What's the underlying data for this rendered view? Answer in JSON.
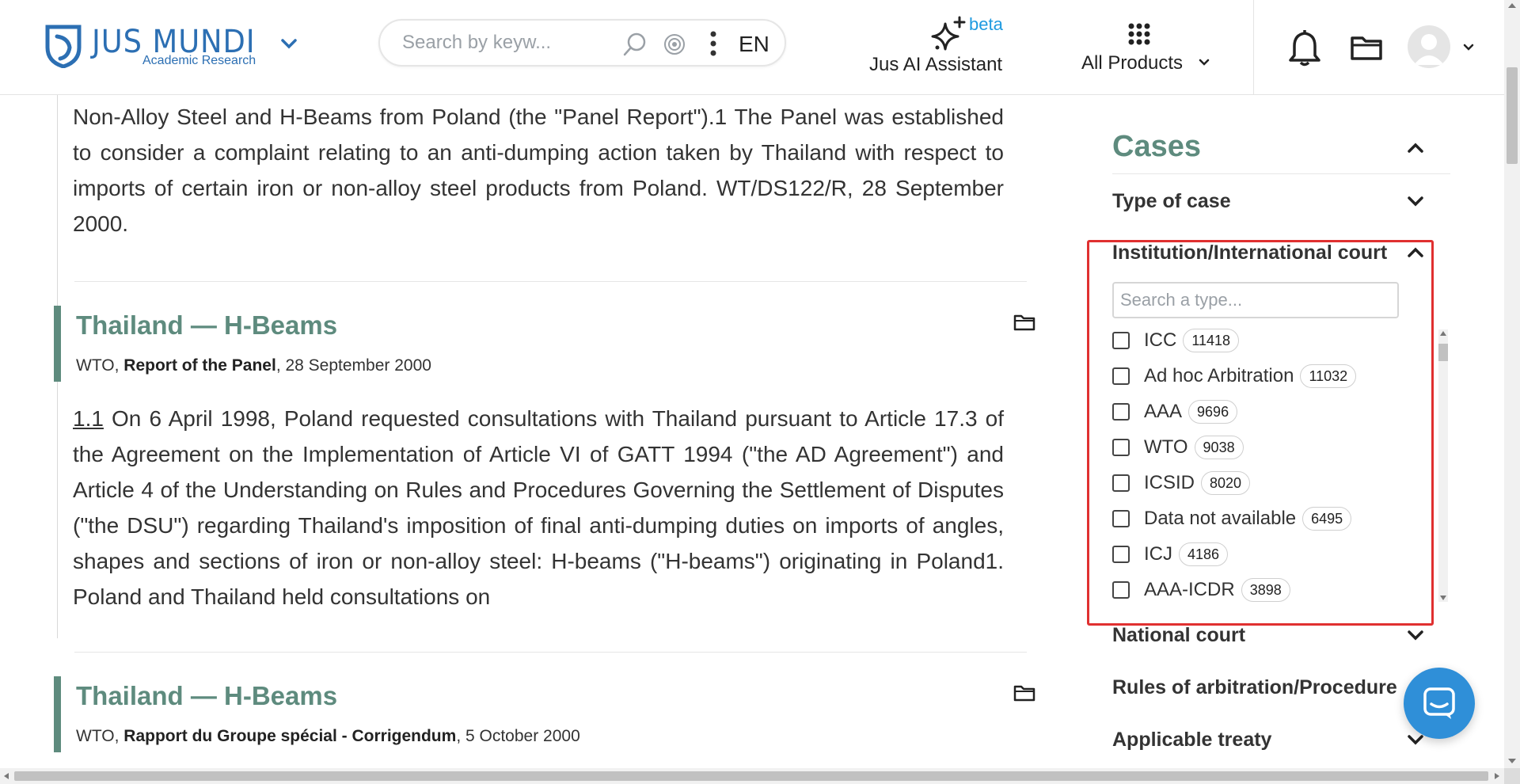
{
  "header": {
    "logo": {
      "name": "JUS MUNDI",
      "subtitle": "Academic Research"
    },
    "search": {
      "placeholder": "Search by keyw...",
      "language": "EN"
    },
    "ai_assistant": {
      "badge": "beta",
      "label": "Jus AI Assistant"
    },
    "products": {
      "label": "All Products"
    }
  },
  "main": {
    "top_fragment": {
      "lines": [
        "Non-Alloy Steel and H-Beams from Poland (the \"Panel Report\").1 The Panel was established to consider a complaint relating to an anti-dumping action taken by Thailand with respect to imports of certain iron or non-alloy steel products from Poland. WT/DS122/R, 28 September 2000."
      ]
    },
    "results": [
      {
        "title": "Thailand — H-Beams",
        "institution": "WTO, ",
        "doc_type": "Report of the Panel",
        "date": ", 28 September 2000",
        "para_num": "1.1",
        "text": " On 6 April 1998, Poland requested consultations with Thailand pursuant to Article 17.3 of the Agreement on the Implementation of Article VI of GATT 1994 (\"the AD Agreement\") and Article 4 of the Understanding on Rules and Procedures Governing the Settlement of Disputes (\"the DSU\") regarding Thailand's imposition of final anti-dumping duties on imports of angles, shapes and sections of iron or non-alloy steel: H-beams (\"H-beams\") originating in Poland1. Poland and Thailand held consultations on"
      },
      {
        "title": "Thailand — H-Beams",
        "institution": "WTO, ",
        "doc_type": "Rapport du Groupe spécial - Corrigendum",
        "date": ", 5 October 2000"
      }
    ]
  },
  "sidebar": {
    "section_title": "Cases",
    "type_of_case": "Type of case",
    "institution_heading": "Institution/International court",
    "type_search_placeholder": "Search a type...",
    "options": [
      {
        "label": "ICC",
        "count": "11418"
      },
      {
        "label": "Ad hoc Arbitration",
        "count": "11032"
      },
      {
        "label": "AAA",
        "count": "9696"
      },
      {
        "label": "WTO",
        "count": "9038"
      },
      {
        "label": "ICSID",
        "count": "8020"
      },
      {
        "label": "Data not available",
        "count": "6495"
      },
      {
        "label": "ICJ",
        "count": "4186"
      },
      {
        "label": "AAA-ICDR",
        "count": "3898"
      }
    ],
    "national_court": "National court",
    "rules_of_arbitration": "Rules of arbitration/Procedure",
    "applicable_treaty": "Applicable treaty"
  },
  "colors": {
    "brand_blue": "#2c6fb3",
    "accent_green": "#5e8b7e",
    "beta_blue": "#1e9ae0",
    "highlight_red": "#e03030",
    "chat_blue": "#2f8fd8"
  },
  "icons": [
    "logo-icon",
    "chevron-down-icon",
    "search-icon",
    "target-icon",
    "more-vertical-icon",
    "sparkles-icon",
    "grid-icon",
    "bell-icon",
    "folder-icon",
    "avatar-icon",
    "chevron-up-icon",
    "chat-icon"
  ]
}
